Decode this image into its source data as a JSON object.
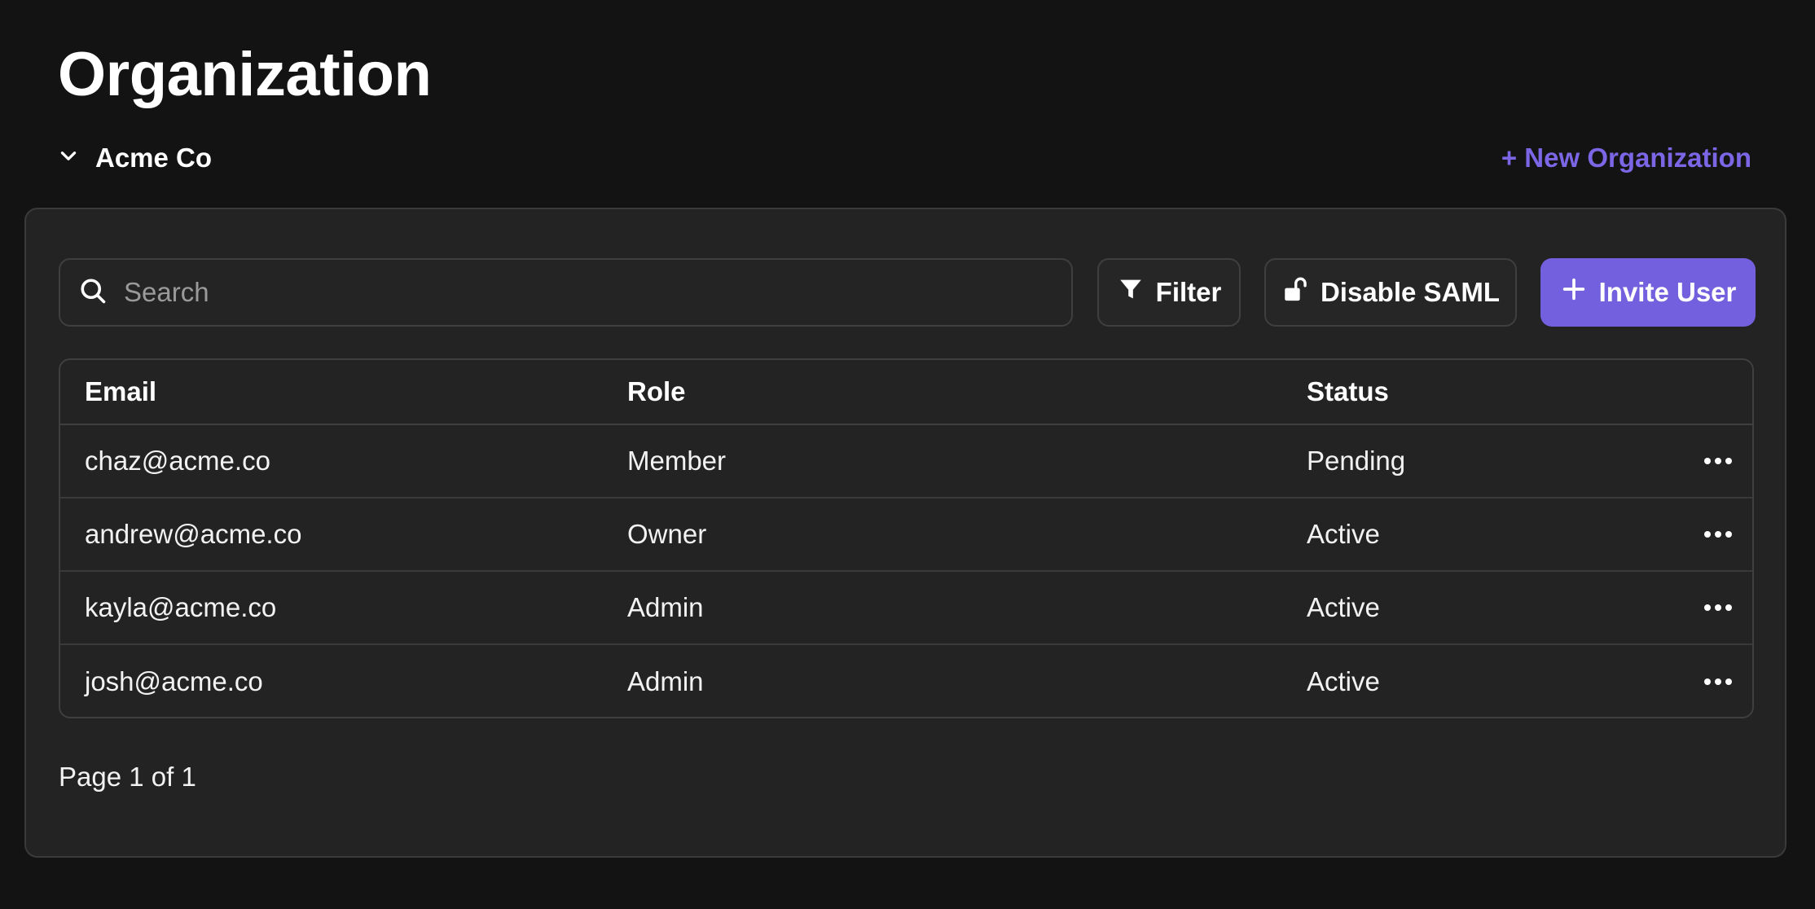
{
  "page": {
    "title": "Organization"
  },
  "org_switcher": {
    "name": "Acme Co",
    "icon": "chevron-down-icon"
  },
  "new_org_link": "+ New Organization",
  "toolbar": {
    "search_placeholder": "Search",
    "search_value": "",
    "filter_label": "Filter",
    "disable_saml_label": "Disable SAML",
    "invite_user_label": "Invite User"
  },
  "table": {
    "headers": {
      "email": "Email",
      "role": "Role",
      "status": "Status"
    },
    "rows": [
      {
        "email": "chaz@acme.co",
        "role": "Member",
        "status": "Pending"
      },
      {
        "email": "andrew@acme.co",
        "role": "Owner",
        "status": "Active"
      },
      {
        "email": "kayla@acme.co",
        "role": "Admin",
        "status": "Active"
      },
      {
        "email": "josh@acme.co",
        "role": "Admin",
        "status": "Active"
      }
    ]
  },
  "pagination": {
    "text": "Page 1 of 1"
  },
  "colors": {
    "background": "#131313",
    "panel": "#232323",
    "accent": "#7360df",
    "link": "#7c66e6"
  }
}
